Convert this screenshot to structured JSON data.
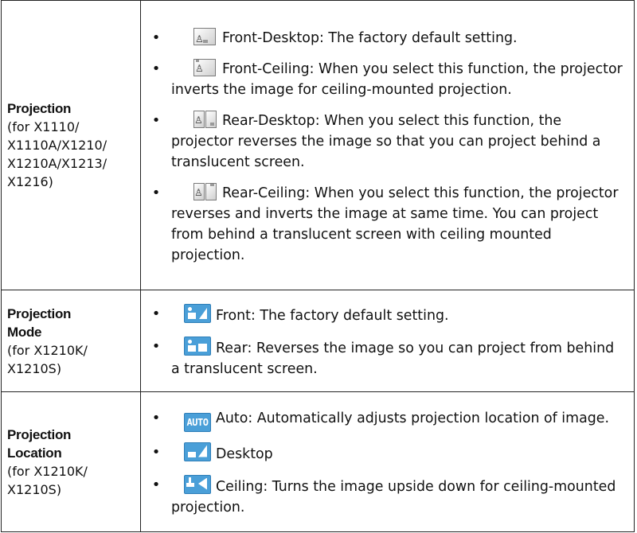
{
  "rows": [
    {
      "label_title": "Projection",
      "label_sub": [
        "(for X1110/",
        "X1110A/X1210/",
        "X1210A/X1213/",
        "X1216)"
      ],
      "items": [
        {
          "icon": "front-desktop-icon",
          "text": "Front-Desktop: The factory default setting."
        },
        {
          "icon": "front-ceiling-icon",
          "text": "Front-Ceiling: When you select this function, the projector inverts the image for ceiling-mounted projection."
        },
        {
          "icon": "rear-desktop-icon",
          "text": "Rear-Desktop: When you select this function, the projector reverses the image so that you can project behind a translucent screen."
        },
        {
          "icon": "rear-ceiling-icon",
          "text": "Rear-Ceiling: When you select this function, the projector reverses and inverts the image at same time. You can project from behind a translucent screen with ceiling mounted projection."
        }
      ]
    },
    {
      "label_title": "Projection Mode",
      "label_title_lines": [
        "Projection",
        "Mode"
      ],
      "label_sub": [
        "(for X1210K/",
        "X1210S)"
      ],
      "items": [
        {
          "icon": "front-mode-icon",
          "text": "Front: The factory default setting."
        },
        {
          "icon": "rear-mode-icon",
          "text": "Rear: Reverses the image so you can project from behind a translucent screen."
        }
      ]
    },
    {
      "label_title": "Projection Location",
      "label_title_lines": [
        "Projection",
        "Location"
      ],
      "label_sub": [
        "(for X1210K/",
        "X1210S)"
      ],
      "items": [
        {
          "icon": "auto-icon",
          "icon_text": "AUTO",
          "text": "Auto: Automatically adjusts projection location of image."
        },
        {
          "icon": "desktop-location-icon",
          "text": "Desktop"
        },
        {
          "icon": "ceiling-location-icon",
          "text": "Ceiling: Turns the image upside down for ceiling-mounted projection."
        }
      ]
    }
  ],
  "colors": {
    "icon_blue": "#4a9fd8",
    "border": "#222222"
  }
}
